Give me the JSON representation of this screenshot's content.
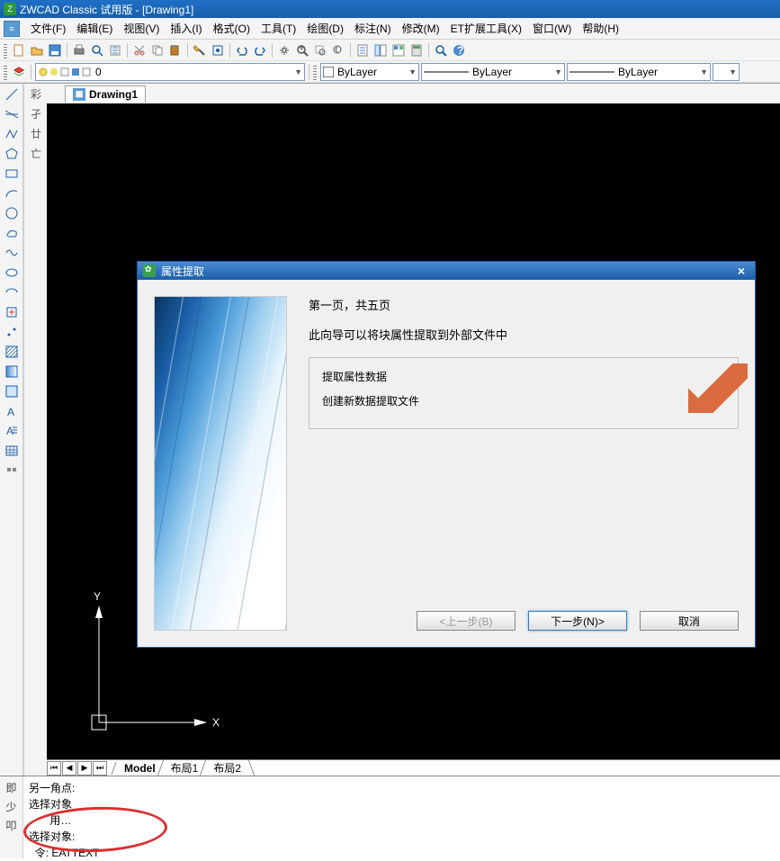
{
  "title": "ZWCAD Classic 试用版 - [Drawing1]",
  "menu": [
    "文件(F)",
    "编辑(E)",
    "视图(V)",
    "插入(I)",
    "格式(O)",
    "工具(T)",
    "绘图(D)",
    "标注(N)",
    "修改(M)",
    "ET扩展工具(X)",
    "窗口(W)",
    "帮助(H)"
  ],
  "layer": {
    "current": "0",
    "bylayer1": "ByLayer",
    "bylayer2": "ByLayer",
    "bylayer3": "ByLayer"
  },
  "doctab": "Drawing1",
  "layout_tabs": [
    "Model",
    "布局1",
    "布局2"
  ],
  "ucs": {
    "x": "X",
    "y": "Y"
  },
  "cmd": {
    "l1": "另一角点:",
    "l2": "选择对象",
    "l3": "       用…",
    "l4": "选择对象:",
    "l5": "  令: EATTEXT"
  },
  "dialog": {
    "title": "属性提取",
    "heading": "第一页，共五页",
    "desc": "此向导可以将块属性提取到外部文件中",
    "opt1": "提取属性数据",
    "opt2": "创建新数据提取文件",
    "back": "<上一步(B)",
    "next": "下一步(N)>",
    "cancel": "取消"
  },
  "lefttool_names": [
    "line",
    "construction-line",
    "polyline",
    "polygon",
    "rectangle",
    "arc",
    "circle",
    "revision-cloud",
    "spline",
    "ellipse",
    "ellipse-arc",
    "insert-block",
    "point",
    "hatch",
    "gradient",
    "region",
    "text",
    "mtext",
    "table",
    "more"
  ]
}
